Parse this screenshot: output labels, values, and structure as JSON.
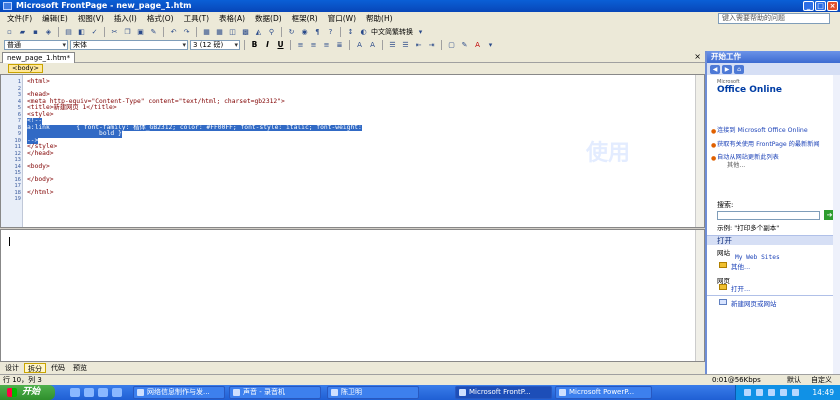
{
  "window": {
    "title": "Microsoft FrontPage - new_page_1.htm"
  },
  "menu": {
    "items": [
      "文件(F)",
      "编辑(E)",
      "视图(V)",
      "插入(I)",
      "格式(O)",
      "工具(T)",
      "表格(A)",
      "数据(D)",
      "框架(R)",
      "窗口(W)",
      "帮助(H)"
    ],
    "help_placeholder": "键入需要帮助的问题"
  },
  "toolbar": {
    "language_label": "中文简繁转换"
  },
  "format_toolbar": {
    "style_value": "普通",
    "font_value": "宋体",
    "size_value": "3 (12 磅)"
  },
  "document": {
    "tab_label": "new_page_1.htm*",
    "tag_selector": "<body>",
    "code_lines": [
      {
        "n": "1",
        "text": "<html>",
        "selected": false
      },
      {
        "n": "2",
        "text": "",
        "selected": false
      },
      {
        "n": "3",
        "text": "<head>",
        "selected": false
      },
      {
        "n": "4",
        "text": "<meta http-equiv=\"Content-Type\" content=\"text/html; charset=gb2312\">",
        "selected": false
      },
      {
        "n": "5",
        "text": "<title>新建网页 1</title>",
        "selected": false
      },
      {
        "n": "6",
        "text": "<style>",
        "selected": false
      },
      {
        "n": "7",
        "text": "<!--",
        "selected": true
      },
      {
        "n": "8",
        "text": "a:link       { font-family: 楷体_GB2312; color: #FF00FF; font-style: italic; font-weight:",
        "selected": true
      },
      {
        "n": "9",
        "text": "                   bold }",
        "selected": true
      },
      {
        "n": "10",
        "text": "-->",
        "selected": true
      },
      {
        "n": "11",
        "text": "</style>",
        "selected": false
      },
      {
        "n": "12",
        "text": "</head>",
        "selected": false
      },
      {
        "n": "13",
        "text": "",
        "selected": false
      },
      {
        "n": "14",
        "text": "<body>",
        "selected": false
      },
      {
        "n": "15",
        "text": "",
        "selected": false
      },
      {
        "n": "16",
        "text": "</body>",
        "selected": false
      },
      {
        "n": "17",
        "text": "",
        "selected": false
      },
      {
        "n": "18",
        "text": "</html>",
        "selected": false
      },
      {
        "n": "19",
        "text": "",
        "selected": false
      }
    ],
    "watermark": "使用"
  },
  "view_tabs": [
    {
      "label": "设计",
      "active": false
    },
    {
      "label": "拆分",
      "active": true
    },
    {
      "label": "代码",
      "active": false
    },
    {
      "label": "预览",
      "active": false
    }
  ],
  "status": {
    "position": "行 10，列 3",
    "speed": "0:01@56Kbps",
    "mode1": "默认",
    "mode2": "自定义"
  },
  "taskpane": {
    "title": "开始工作",
    "office_logo": "Office Online",
    "office_links": [
      "连接到 Microsoft Office Online",
      "获取有关使用 FrontPage 的最新新闻",
      "自动从网站更新此列表"
    ],
    "more": "其他...",
    "search_label": "搜索:",
    "example_label": "示例: \"打印多个副本\"",
    "open_section": "打开",
    "sites_label": "网站",
    "sites_value": "My Web Sites",
    "sites_more": "其他...",
    "pages_label": "网页",
    "pages_open": "打开...",
    "new_section_link": "新建网页或网站"
  },
  "taskbar": {
    "start_label": "开始",
    "tasks": [
      {
        "label": "网络信息制作与发...",
        "active": false
      },
      {
        "label": "声音 - 录音机",
        "active": false
      },
      {
        "label": "陈卫明",
        "active": false
      },
      {
        "label": "Microsoft FrontP...",
        "active": true
      },
      {
        "label": "Microsoft PowerP...",
        "active": false
      }
    ],
    "clock": "14:49"
  }
}
